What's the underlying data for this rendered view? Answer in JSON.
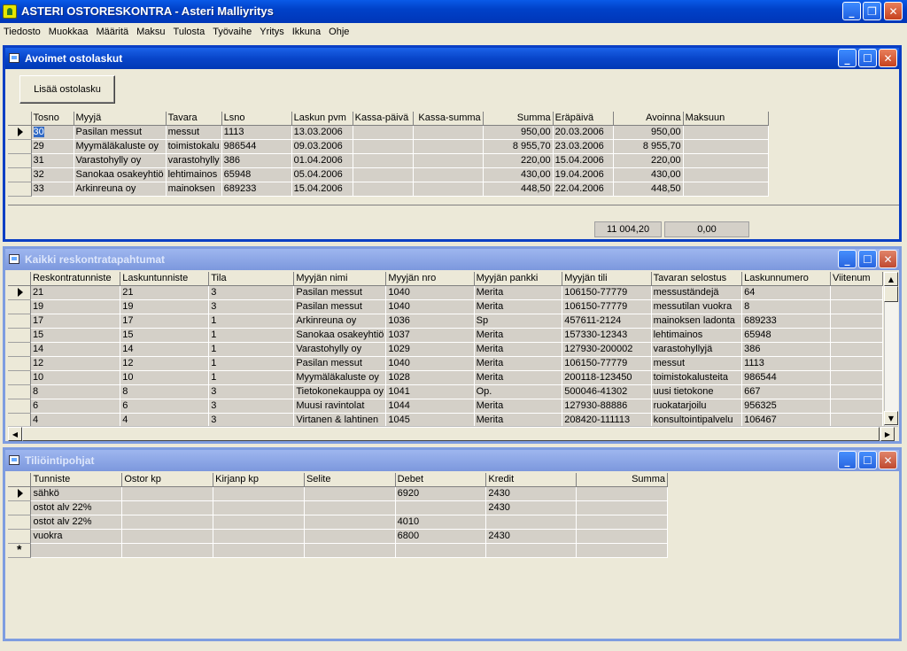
{
  "app": {
    "title": "ASTERI OSTORESKONTRA - Asteri Malliyritys",
    "minimize": "_",
    "restore": "❐",
    "close": "✕"
  },
  "menu": [
    "Tiedosto",
    "Muokkaa",
    "Määritä",
    "Maksu",
    "Tulosta",
    "Työvaihe",
    "Yritys",
    "Ikkuna",
    "Ohje"
  ],
  "invoices": {
    "title": "Avoimet ostolaskut",
    "add_button": "Lisää ostolasku",
    "columns": [
      "Tosno",
      "Myyjä",
      "Tavara",
      "Lsno",
      "Laskun pvm",
      "Kassa-päivä",
      "Kassa-summa",
      "Summa",
      "Eräpäivä",
      "Avoinna",
      "Maksuun"
    ],
    "rows": [
      [
        "30",
        "Pasilan messut",
        "messut",
        "1113",
        "13.03.2006",
        "",
        "",
        "950,00",
        "20.03.2006",
        "950,00",
        ""
      ],
      [
        "29",
        "Myymäläkaluste oy",
        "toimistokalu",
        "986544",
        "09.03.2006",
        "",
        "",
        "8 955,70",
        "23.03.2006",
        "8 955,70",
        ""
      ],
      [
        "31",
        "Varastohylly oy",
        "varastohylly",
        "386",
        "01.04.2006",
        "",
        "",
        "220,00",
        "15.04.2006",
        "220,00",
        ""
      ],
      [
        "32",
        "Sanokaa osakeyhtiö",
        "lehtimainos",
        "65948",
        "05.04.2006",
        "",
        "",
        "430,00",
        "19.04.2006",
        "430,00",
        ""
      ],
      [
        "33",
        "Arkinreuna oy",
        "mainoksen",
        "689233",
        "15.04.2006",
        "",
        "",
        "448,50",
        "22.04.2006",
        "448,50",
        ""
      ]
    ],
    "total_open": "11 004,20",
    "total_pay": "0,00"
  },
  "ledger": {
    "title": "Kaikki reskontratapahtumat",
    "columns": [
      "Reskontratunniste",
      "Laskuntunniste",
      "Tila",
      "Myyjän nimi",
      "Myyjän nro",
      "Myyjän pankki",
      "Myyjän tili",
      "Tavaran selostus",
      "Laskunnumero",
      "Viitenum"
    ],
    "rows": [
      [
        "21",
        "21",
        "3",
        "Pasilan messut",
        "1040",
        "Merita",
        "106150-77779",
        "messuständejä",
        "64",
        ""
      ],
      [
        "19",
        "19",
        "3",
        "Pasilan messut",
        "1040",
        "Merita",
        "106150-77779",
        "messutilan vuokra",
        "8",
        ""
      ],
      [
        "17",
        "17",
        "1",
        "Arkinreuna oy",
        "1036",
        "Sp",
        "457611-2124",
        "mainoksen ladonta",
        "689233",
        ""
      ],
      [
        "15",
        "15",
        "1",
        "Sanokaa osakeyhtiö",
        "1037",
        "Merita",
        "157330-12343",
        "lehtimainos",
        "65948",
        ""
      ],
      [
        "14",
        "14",
        "1",
        "Varastohylly oy",
        "1029",
        "Merita",
        "127930-200002",
        "varastohyllyjä",
        "386",
        ""
      ],
      [
        "12",
        "12",
        "1",
        "Pasilan messut",
        "1040",
        "Merita",
        "106150-77779",
        "messut",
        "1113",
        ""
      ],
      [
        "10",
        "10",
        "1",
        "Myymäläkaluste oy",
        "1028",
        "Merita",
        "200118-123450",
        "toimistokalusteita",
        "986544",
        ""
      ],
      [
        "8",
        "8",
        "3",
        "Tietokonekauppa oy",
        "1041",
        "Op.",
        "500046-41302",
        "uusi tietokone",
        "667",
        ""
      ],
      [
        "6",
        "6",
        "3",
        "Muusi ravintolat",
        "1044",
        "Merita",
        "127930-88886",
        "ruokatarjoilu",
        "956325",
        ""
      ],
      [
        "4",
        "4",
        "3",
        "Virtanen & lahtinen",
        "1045",
        "Merita",
        "208420-111113",
        "konsultointipalvelu",
        "106467",
        ""
      ]
    ]
  },
  "templates": {
    "title": "Tiliöintipohjat",
    "columns": [
      "Tunniste",
      "Ostor kp",
      "Kirjanp kp",
      "Selite",
      "Debet",
      "Kredit",
      "Summa"
    ],
    "rows": [
      [
        "sähkö",
        "",
        "",
        "",
        "6920",
        "2430",
        ""
      ],
      [
        "ostot alv 22%",
        "",
        "",
        "",
        "",
        "2430",
        ""
      ],
      [
        "ostot alv 22%",
        "",
        "",
        "",
        "4010",
        "",
        ""
      ],
      [
        "vuokra",
        "",
        "",
        "",
        "6800",
        "2430",
        ""
      ],
      [
        "",
        "",
        "",
        "",
        "",
        "",
        ""
      ]
    ],
    "new_row_marker": "*"
  }
}
